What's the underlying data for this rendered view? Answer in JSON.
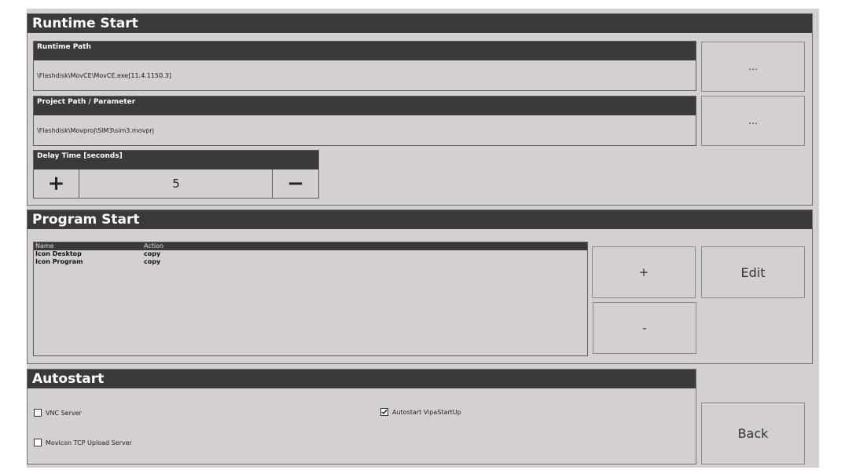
{
  "runtime_start": {
    "title": "Runtime Start",
    "runtime_path": {
      "label": "Runtime Path",
      "value": "\\Flashdisk\\MovCE\\MovCE.exe[11.4.1150.3]",
      "browse_label": "..."
    },
    "project_path": {
      "label": "Project Path / Parameter",
      "value": "\\Flashdisk\\Movproj\\SIM3\\sim3.movprj",
      "browse_label": "..."
    },
    "delay": {
      "label": "Delay Time [seconds]",
      "value": "5",
      "increment_label": "+",
      "decrement_label": "−"
    }
  },
  "program_start": {
    "title": "Program Start",
    "columns": [
      "Name",
      "Action"
    ],
    "rows": [
      {
        "name": "Icon Desktop",
        "action": "copy"
      },
      {
        "name": "Icon Program",
        "action": "copy"
      }
    ],
    "add_label": "+",
    "remove_label": "-",
    "edit_label": "Edit"
  },
  "autostart": {
    "title": "Autostart",
    "options": [
      {
        "label": "VNC Server",
        "checked": false
      },
      {
        "label": "Autostart VipaStartUp",
        "checked": true
      },
      {
        "label": "Movicon TCP Upload Server",
        "checked": false
      }
    ]
  },
  "back_label": "Back",
  "colors": {
    "background": "#d4d0d1",
    "header": "#3a3a3a",
    "header_text": "#ffffff"
  }
}
